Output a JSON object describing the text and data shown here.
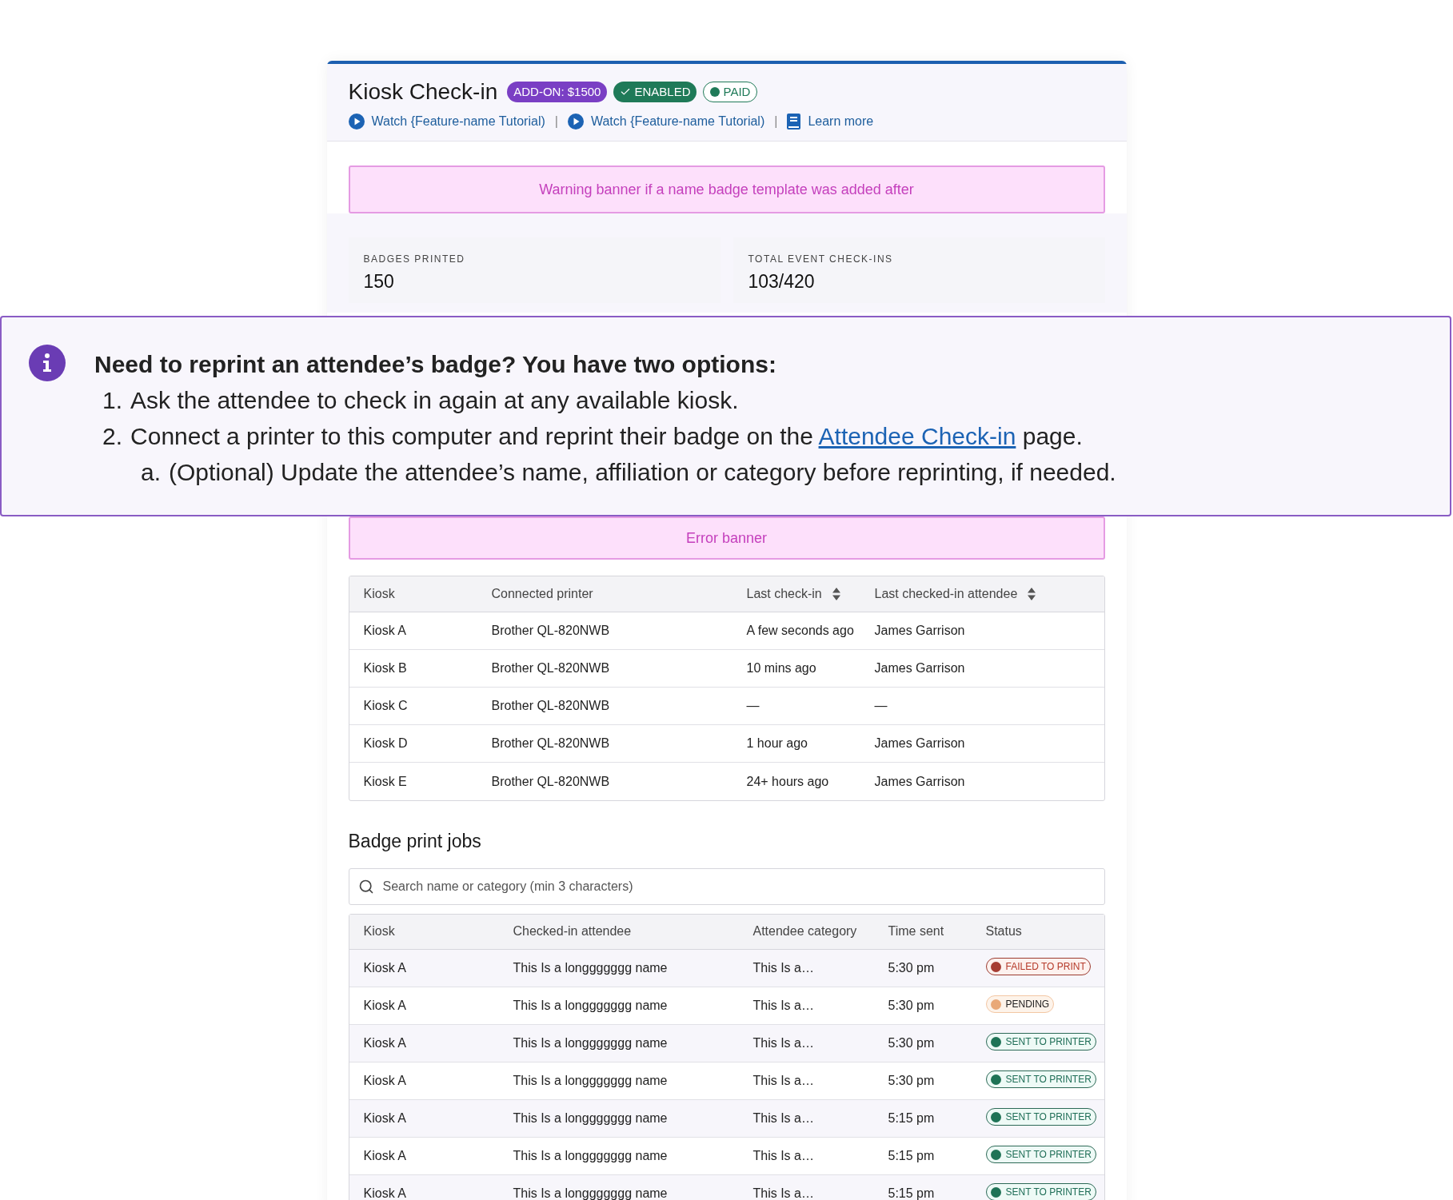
{
  "header": {
    "title": "Kiosk Check-in",
    "badges": [
      {
        "kind": "addon",
        "label": "ADD-ON: $1500"
      },
      {
        "kind": "enabled",
        "label": "ENABLED"
      },
      {
        "kind": "paid",
        "label": "PAID"
      }
    ],
    "links": [
      {
        "kind": "video",
        "label": "Watch {Feature-name Tutorial)"
      },
      {
        "kind": "video",
        "label": "Watch {Feature-name Tutorial)"
      },
      {
        "kind": "book",
        "label": "Learn more"
      }
    ],
    "separator": "|"
  },
  "warning_banner": "Warning banner if a name badge template was added after",
  "stats": [
    {
      "label": "BADGES PRINTED",
      "value": "150"
    },
    {
      "label": "TOTAL EVENT CHECK-INS",
      "value": "103/420"
    }
  ],
  "callout": {
    "heading": "Need to reprint an attendee’s badge? You have two options:",
    "items": [
      {
        "marker": "1.",
        "text": "Ask the attendee to check in again at any available kiosk."
      },
      {
        "marker": "2.",
        "before": "Connect a printer to this computer and reprint their badge on the",
        "link": "Attendee Check-in",
        "after": "page.",
        "children": [
          {
            "marker": "a.",
            "text": "(Optional) Update the attendee’s name, affiliation or category before reprinting, if needed."
          }
        ]
      }
    ]
  },
  "error_banner": "Error banner",
  "kiosk_table": {
    "columns": [
      {
        "label": "Kiosk",
        "sortable": false
      },
      {
        "label": "Connected printer",
        "sortable": false
      },
      {
        "label": "Last check-in",
        "sortable": true
      },
      {
        "label": "Last checked-in attendee",
        "sortable": true
      }
    ],
    "rows": [
      [
        "Kiosk A",
        "Brother QL-820NWB",
        "A few seconds ago",
        "James Garrison"
      ],
      [
        "Kiosk B",
        "Brother QL-820NWB",
        "10 mins ago",
        "James Garrison"
      ],
      [
        "Kiosk C",
        "Brother QL-820NWB",
        "—",
        "—"
      ],
      [
        "Kiosk D",
        "Brother QL-820NWB",
        "1 hour ago",
        "James Garrison"
      ],
      [
        "Kiosk E",
        "Brother QL-820NWB",
        "24+ hours ago",
        "James Garrison"
      ]
    ]
  },
  "print_jobs": {
    "title": "Badge print jobs",
    "search": {
      "placeholder": "Search name or category (min 3 characters)"
    },
    "columns": [
      "Kiosk",
      "Checked-in attendee",
      "Attendee category",
      "Time sent",
      "Status"
    ],
    "rows": [
      {
        "cells": [
          "Kiosk A",
          "This Is a longgggggg name",
          "This Is a…",
          "5:30 pm"
        ],
        "status": {
          "kind": "failed",
          "label": "FAILED TO PRINT"
        }
      },
      {
        "cells": [
          "Kiosk A",
          "This Is a longgggggg name",
          "This Is a…",
          "5:30 pm"
        ],
        "status": {
          "kind": "pending",
          "label": "PENDING"
        }
      },
      {
        "cells": [
          "Kiosk A",
          "This Is a longgggggg name",
          "This Is a…",
          "5:30 pm"
        ],
        "status": {
          "kind": "sent",
          "label": "SENT TO PRINTER"
        }
      },
      {
        "cells": [
          "Kiosk A",
          "This Is a longgggggg name",
          "This Is a…",
          "5:30 pm"
        ],
        "status": {
          "kind": "sent",
          "label": "SENT TO PRINTER"
        }
      },
      {
        "cells": [
          "Kiosk A",
          "This Is a longgggggg name",
          "This Is a…",
          "5:15 pm"
        ],
        "status": {
          "kind": "sent",
          "label": "SENT TO PRINTER"
        }
      },
      {
        "cells": [
          "Kiosk A",
          "This Is a longgggggg name",
          "This Is a…",
          "5:15 pm"
        ],
        "status": {
          "kind": "sent",
          "label": "SENT TO PRINTER"
        }
      },
      {
        "cells": [
          "Kiosk A",
          "This Is a longgggggg name",
          "This Is a…",
          "5:15 pm"
        ],
        "status": {
          "kind": "sent",
          "label": "SENT TO PRINTER"
        }
      }
    ]
  }
}
